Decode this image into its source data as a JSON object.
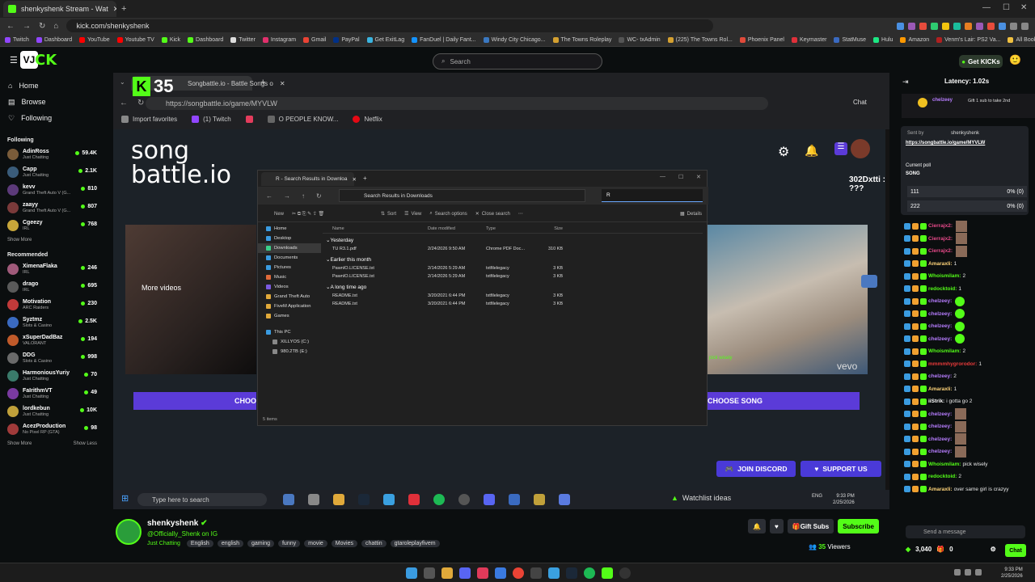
{
  "browser": {
    "tab_title": "shenkyshenk Stream - Wat",
    "url": "kick.com/shenkyshenk",
    "bookmarks": [
      "Twitch",
      "Dashboard",
      "YouTube",
      "Youtube TV",
      "Kick",
      "Dashboard",
      "Twitter",
      "Instagram",
      "Gmail",
      "PayPal",
      "Get ExitLag",
      "FanDuel | Daily Fant...",
      "Windy City Chicago...",
      "The Towns Roleplay",
      "WC- txAdmin",
      "(225) The Towns Rol...",
      "Phoenix Panel",
      "Keymaster",
      "StatMuse",
      "Hulu",
      "Amazon",
      "Venm's Lair: PS2 Va...",
      "All Bookmarks"
    ]
  },
  "header": {
    "search_placeholder": "Search",
    "get_kicks": "Get KICKs"
  },
  "sidebar": {
    "nav": [
      "Home",
      "Browse",
      "Following"
    ],
    "following_title": "Following",
    "following": [
      {
        "name": "AdinRoss",
        "category": "Just Chatting",
        "viewers": "59.4K",
        "color": "#7a5c3a"
      },
      {
        "name": "Capp",
        "category": "Just Chatting",
        "viewers": "2.1K",
        "color": "#3a5c7a"
      },
      {
        "name": "kevv",
        "category": "Grand Theft Auto V (G...",
        "viewers": "810",
        "color": "#5c3a7a"
      },
      {
        "name": "zaayy",
        "category": "Grand Theft Auto V (G...",
        "viewers": "807",
        "color": "#7a3a3a"
      },
      {
        "name": "Cgeezy",
        "category": "IRL",
        "viewers": "768",
        "color": "#c7a63a"
      }
    ],
    "show_more": "Show More",
    "recommended_title": "Recommended",
    "recommended": [
      {
        "name": "XimenaFlaka",
        "category": "IRL",
        "viewers": "246",
        "color": "#a05a7a"
      },
      {
        "name": "drago",
        "category": "IRL",
        "viewers": "695",
        "color": "#5a5a5a"
      },
      {
        "name": "Motivation",
        "category": "ARC Raiders",
        "viewers": "230",
        "color": "#c03a3a"
      },
      {
        "name": "Syztmz",
        "category": "Slots & Casino",
        "viewers": "2.5K",
        "color": "#3a6ac0"
      },
      {
        "name": "xSuperDadBaz",
        "category": "VALORANT",
        "viewers": "194",
        "color": "#c05a2a"
      },
      {
        "name": "DDG",
        "category": "Slots & Casino",
        "viewers": "998",
        "color": "#6a6a6a"
      },
      {
        "name": "HarmoniousYuriy",
        "category": "Just Chatting",
        "viewers": "70",
        "color": "#3a7a6a"
      },
      {
        "name": "FaIrithmVT",
        "category": "Just Chatting",
        "viewers": "49",
        "color": "#7a3aa0"
      },
      {
        "name": "lordkebun",
        "category": "Just Chatting",
        "viewers": "10K",
        "color": "#c0a03a"
      },
      {
        "name": "AcezProduction",
        "category": "No Pixel RP (GTA)",
        "viewers": "98",
        "color": "#a03a3a"
      }
    ],
    "show_less": "Show Less"
  },
  "stream": {
    "kick_count": "35",
    "inner_tab": "Songbattle.io - Battle Songs o",
    "inner_url": "https://songbattle.io/game/MYVLW",
    "inner_bookmarks": [
      "Import favorites",
      "(1) Twitch",
      "O PEOPLE KNOW...",
      "Netflix"
    ],
    "logo_line1": "song",
    "logo_line2": "battle.io",
    "more_videos": "More videos",
    "choose_left": "CHOO",
    "choose_right": "CHOOSE SONG",
    "join_discord": "JOIN DISCORD",
    "support_us": "SUPPORT US",
    "vevo": "vevo",
    "pick_wisely": "pick wisely",
    "overlay_text": "302Dxtti : ???",
    "explorer": {
      "tab": "R - Search Results in Downloa",
      "path": "Search Results in Downloads",
      "search_value": "R",
      "commands": [
        "New",
        "Sort",
        "View",
        "Search options",
        "Close search",
        "Details"
      ],
      "side": [
        "Home",
        "Desktop",
        "Downloads",
        "Documents",
        "Pictures",
        "Music",
        "Videos",
        "Grand Theft Auto",
        "FiveM Application",
        "Games",
        "This PC",
        "XILLYOS (C:)",
        "980.2TB (E:)"
      ],
      "columns": [
        "Name",
        "Date modified",
        "Type",
        "Size"
      ],
      "groups": [
        {
          "label": "Yesterday",
          "rows": [
            {
              "name": "TU R3.1.pdf",
              "date": "2/24/2026 9:50 AM",
              "type": "Chrome PDF Doc...",
              "size": "310 KB"
            }
          ]
        },
        {
          "label": "Earlier this month",
          "rows": [
            {
              "name": "PawnIO.LICENSE.txt",
              "date": "2/14/2026 5:29 AM",
              "type": "txtfilelegacy",
              "size": "3 KB"
            },
            {
              "name": "PawnIO.LICENSE.txt",
              "date": "2/14/2026 5:29 AM",
              "type": "txtfilelegacy",
              "size": "3 KB"
            }
          ]
        },
        {
          "label": "A long time ago",
          "rows": [
            {
              "name": "README.txt",
              "date": "3/20/2021 6:44 PM",
              "type": "txtfilelegacy",
              "size": "3 KB"
            },
            {
              "name": "README.txt",
              "date": "3/20/2021 6:44 PM",
              "type": "txtfilelegacy",
              "size": "3 KB"
            }
          ]
        }
      ],
      "status": "5 items"
    },
    "taskbar_search": "Type here to search",
    "watchlist": "Watchlist ideas",
    "lang": "ENG",
    "time": "9:33 PM",
    "date": "2/25/2026"
  },
  "chat": {
    "latency": "Latency: 1.02s",
    "pinned_user": "chelzeey",
    "pinned_text": "Gift 1 sub to take 2nd",
    "sent_by": "Sent by",
    "sent_user": "shenkyshenk",
    "sent_link": "https://songbattle.io/game/MYVLW",
    "poll_title": "Current poll",
    "poll_q": "SONG",
    "poll_options": [
      {
        "label": "111",
        "result": "0% (0)"
      },
      {
        "label": "222",
        "result": "0% (0)"
      }
    ],
    "messages": [
      {
        "user": "Cierrajx2:",
        "text": "",
        "color": "#e84a8a",
        "emote": "sq"
      },
      {
        "user": "Cierrajx2:",
        "text": "",
        "color": "#e84a8a",
        "emote": "sq"
      },
      {
        "user": "Cierrajx2:",
        "text": "",
        "color": "#e84a8a",
        "emote": "sq"
      },
      {
        "user": "Amaraxli:",
        "text": "1",
        "color": "#ffd479",
        "emote": ""
      },
      {
        "user": "Whoismilam:",
        "text": "2",
        "color": "#53fc18",
        "emote": ""
      },
      {
        "user": "redocktoid:",
        "text": "1",
        "color": "#53fc18",
        "emote": ""
      },
      {
        "user": "chelzeey:",
        "text": "",
        "color": "#b77dff",
        "emote": "g"
      },
      {
        "user": "chelzeey:",
        "text": "",
        "color": "#b77dff",
        "emote": "g"
      },
      {
        "user": "chelzeey:",
        "text": "",
        "color": "#b77dff",
        "emote": "g"
      },
      {
        "user": "chelzeey:",
        "text": "",
        "color": "#b77dff",
        "emote": "g"
      },
      {
        "user": "Whoismilam:",
        "text": "2",
        "color": "#53fc18",
        "emote": ""
      },
      {
        "user": "mmmmhygrorodor:",
        "text": "1",
        "color": "#e83a3a",
        "emote": ""
      },
      {
        "user": "chelzeey:",
        "text": "2",
        "color": "#b77dff",
        "emote": ""
      },
      {
        "user": "Amaraxli:",
        "text": "1",
        "color": "#ffd479",
        "emote": ""
      },
      {
        "user": "iiStrik:",
        "text": "i gotta go 2",
        "color": "#ffffff",
        "emote": ""
      },
      {
        "user": "chelzeey:",
        "text": "",
        "color": "#b77dff",
        "emote": "sq"
      },
      {
        "user": "chelzeey:",
        "text": "",
        "color": "#b77dff",
        "emote": "sq"
      },
      {
        "user": "chelzeey:",
        "text": "",
        "color": "#b77dff",
        "emote": "sq"
      },
      {
        "user": "chelzeey:",
        "text": "",
        "color": "#b77dff",
        "emote": "sq"
      },
      {
        "user": "Whoismilam:",
        "text": "pick wisely",
        "color": "#53fc18",
        "emote": ""
      },
      {
        "user": "redocktoid:",
        "text": "2",
        "color": "#53fc18",
        "emote": ""
      },
      {
        "user": "Amaraxli:",
        "text": "over same girl is crazyy",
        "color": "#ffd479",
        "emote": ""
      }
    ],
    "input_placeholder": "Send a message",
    "points": "3,040",
    "zero": "0",
    "chat_btn": "Chat"
  },
  "streamer": {
    "name": "shenkyshenk",
    "social": "@Officially_Shenk on IG",
    "category": "Just Chatting",
    "tags": [
      "English",
      "english",
      "gaming",
      "funny",
      "movie",
      "Movies",
      "chattin",
      "gtaroleplayfivem"
    ],
    "gift_subs": "Gift Subs",
    "subscribe": "Subscribe",
    "viewers": "35",
    "viewers_label": "Viewers"
  },
  "os": {
    "time": "9:33 PM",
    "date": "2/25/2026"
  }
}
